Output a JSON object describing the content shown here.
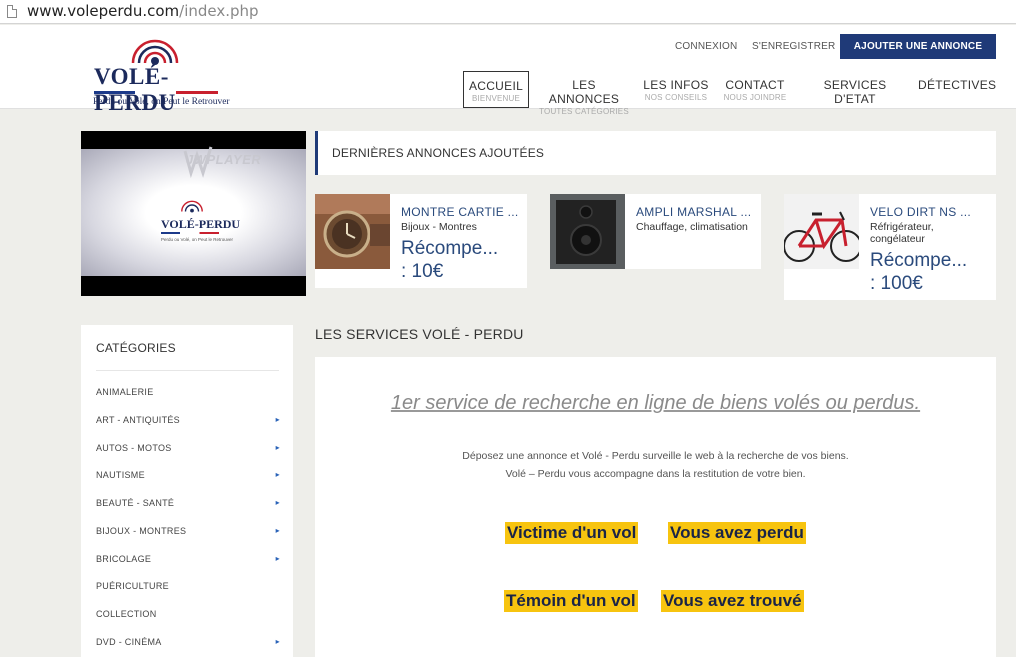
{
  "browser": {
    "url_host": "www.voleperdu.com",
    "url_path": "/index.php"
  },
  "header": {
    "logo": {
      "brand": "VOLÉ-PERDU",
      "tagline": "Perdu ou Volé, on Peut le Retrouver"
    },
    "top_links": {
      "login": "CONNEXION",
      "register": "S'ENREGISTRER"
    },
    "add_ad_button": "AJOUTER UNE ANNONCE",
    "nav": [
      {
        "label": "ACCUEIL",
        "sub": "BIENVENUE"
      },
      {
        "label": "LES ANNONCES",
        "sub": "TOUTES CATÉGORIES"
      },
      {
        "label": "LES INFOS",
        "sub": "NOS CONSEILS"
      },
      {
        "label": "CONTACT",
        "sub": "NOUS JOINDRE"
      },
      {
        "label": "SERVICES D'ETAT",
        "sub": ""
      },
      {
        "label": "DÉTECTIVES",
        "sub": ""
      }
    ]
  },
  "video": {
    "player": "JWPLAYER",
    "brand": "VOLÉ-PERDU",
    "subtitle": "Perdu ou Volé, on Peut le Retrouver"
  },
  "latest": {
    "heading": "DERNIÈRES ANNONCES AJOUTÉES",
    "cards": [
      {
        "title": "MONTRE CARTIE ...",
        "category": "Bijoux - Montres",
        "reward_line1": "Récompe...",
        "reward_line2": ": 10€"
      },
      {
        "title": "AMPLI MARSHAL ...",
        "category": "Chauffage, climatisation",
        "reward_line1": "",
        "reward_line2": ""
      },
      {
        "title": "VELO DIRT NS ...",
        "category": "Réfrigérateur, congélateur",
        "reward_line1": "Récompe...",
        "reward_line2": ": 100€"
      }
    ]
  },
  "sidebar": {
    "heading": "CATÉGORIES",
    "items": [
      {
        "label": "ANIMALERIE",
        "arrow": ""
      },
      {
        "label": "ART - ANTIQUITÉS",
        "arrow": "▸"
      },
      {
        "label": "AUTOS - MOTOS",
        "arrow": "▸"
      },
      {
        "label": "NAUTISME",
        "arrow": "▸"
      },
      {
        "label": "BEAUTÉ - SANTÉ",
        "arrow": "▸"
      },
      {
        "label": "BIJOUX - MONTRES",
        "arrow": "▸"
      },
      {
        "label": "BRICOLAGE",
        "arrow": "▸"
      },
      {
        "label": "PUÉRICULTURE",
        "arrow": ""
      },
      {
        "label": "COLLECTION",
        "arrow": ""
      },
      {
        "label": "DVD - CINÉMA",
        "arrow": "▸"
      }
    ]
  },
  "services": {
    "title": "LES SERVICES VOLÉ - PERDU",
    "tagline": "1er service de recherche en ligne de biens volés ou perdus.",
    "desc_line1": "Déposez une annonce et Volé - Perdu surveille le web à la recherche de vos biens.",
    "desc_line2": "Volé – Perdu vous accompagne dans la restitution de votre bien.",
    "buttons": {
      "victim": "Victime d'un vol",
      "lost": "Vous avez perdu",
      "witness": "Témoin d'un vol",
      "found": "Vous  avez trouvé"
    }
  },
  "colors": {
    "primary": "#1f3a78",
    "accent_yellow": "#f7c40f",
    "link_blue": "#2a4a7c",
    "background": "#eeeeea"
  }
}
